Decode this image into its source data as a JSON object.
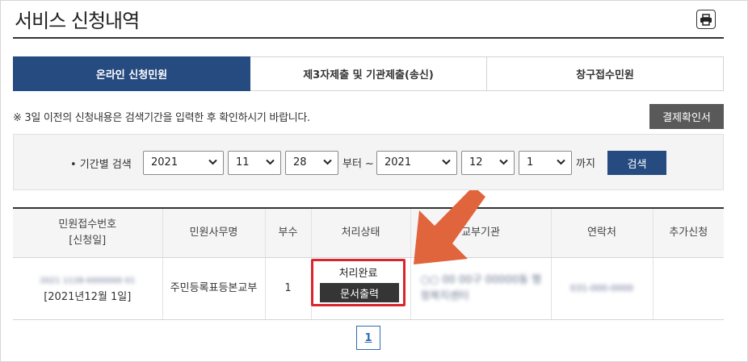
{
  "page": {
    "title": "서비스 신청내역"
  },
  "print_button": {
    "icon": "printer-icon"
  },
  "tabs": [
    {
      "label": "온라인 신청민원",
      "active": true
    },
    {
      "label": "제3자제출 및 기관제출(송신)",
      "active": false
    },
    {
      "label": "창구접수민원",
      "active": false
    }
  ],
  "notice": "※ 3일 이전의 신청내용은 검색기간을 입력한 후 확인하시기 바랍니다.",
  "confirm_button": "결제확인서",
  "search": {
    "label": "• 기간별 검색",
    "from_year": "2021",
    "from_month": "11",
    "from_day": "28",
    "separator": "부터 ~",
    "to_year": "2021",
    "to_month": "12",
    "to_day": "1",
    "suffix": "까지",
    "button": "검색"
  },
  "table": {
    "headers": [
      "민원접수번호",
      "[신청일]",
      "민원사무명",
      "부수",
      "처리상태",
      "교부기관",
      "연락처",
      "추가신청"
    ],
    "rows": [
      {
        "receipt_no": "2021 1128-0000000 01",
        "apply_date": "[2021년12월 1일]",
        "service_name": "주민등록표등본교부",
        "copies": "1",
        "status": "처리완료",
        "status_button": "문서출력",
        "agency": "○○ 00 00구 00000동 행정복지센터",
        "contact": "031-000-0000",
        "extra": ""
      }
    ]
  },
  "annotation": {
    "arrow_color": "#e0643c",
    "highlight_color": "#d9262c"
  },
  "pagination": {
    "current": "1"
  }
}
